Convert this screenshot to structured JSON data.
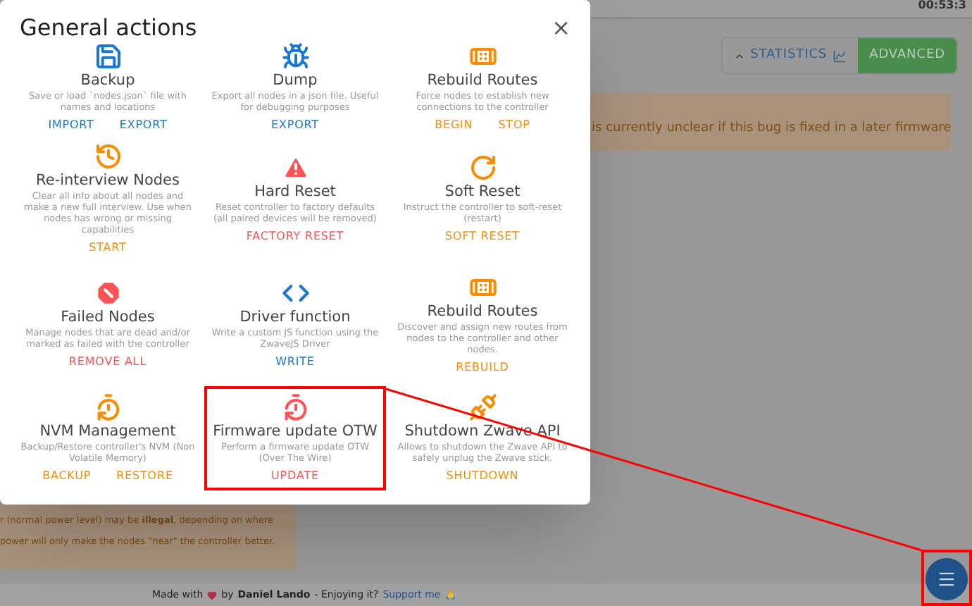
{
  "top_bar": {
    "clock": "00:53:3"
  },
  "toolbar": {
    "buttons": [
      {
        "label": "STATISTICS",
        "kind": "outline"
      },
      {
        "label": "ADVANCED",
        "kind": "filled"
      }
    ]
  },
  "alert_top": {
    "text": "is currently unclear if this bug is fixed in a later firmware"
  },
  "alert_bottom": {
    "lines": [
      "r (normal power level) may be **illegal**, depending on where",
      "power will only make the nodes \"near\" the controller better."
    ]
  },
  "footer": {
    "made_with": "Made with",
    "by": "by",
    "author": "Daniel Lando",
    "enjoying": "- Enjoying it?",
    "link": "Support me",
    "emoji": "🙏"
  },
  "dialog": {
    "title": "General actions",
    "close": "×",
    "actions": [
      {
        "kind": "save",
        "color": "#1976d2",
        "title": "Backup",
        "description": "Save or load `nodes.json` file with names and locations",
        "buttons": [
          "IMPORT",
          "EXPORT"
        ],
        "highlighted": false
      },
      {
        "kind": "bug",
        "color": "#1976d2",
        "title": "Dump",
        "description": "Export all nodes in a json file. Useful for debugging purposes",
        "buttons": [
          "EXPORT"
        ],
        "highlighted": false
      },
      {
        "kind": "bandage",
        "color": "#fb8c00",
        "title": "Rebuild Routes",
        "description": "Force nodes to establish new connections to the controller",
        "buttons": [
          "BEGIN",
          "STOP"
        ],
        "highlighted": false
      },
      {
        "kind": "history",
        "color": "#fb8c00",
        "title": "Re-interview Nodes",
        "description": "Clear all info about all nodes and make a new full interview. Use when nodes has wrong or missing capabilities",
        "buttons": [
          "START"
        ],
        "highlighted": false
      },
      {
        "kind": "warning",
        "color": "#ff5252",
        "title": "Hard Reset",
        "description": "Reset controller to factory defaults (all paired devices will be removed)",
        "buttons": [
          "FACTORY RESET"
        ],
        "highlighted": false
      },
      {
        "kind": "refresh",
        "color": "#fb8c00",
        "title": "Soft Reset",
        "description": "Instruct the controller to soft-reset (restart)",
        "buttons": [
          "SOFT RESET"
        ],
        "highlighted": false
      },
      {
        "kind": "cross",
        "color": "#ff5252",
        "title": "Failed Nodes",
        "description": "Manage nodes that are dead and/or marked as failed with the controller",
        "buttons": [
          "REMOVE ALL"
        ],
        "highlighted": false
      },
      {
        "kind": "code",
        "color": "#1976d2",
        "title": "Driver function",
        "description": "Write a custom JS function using the ZwaveJS Driver",
        "buttons": [
          "WRITE"
        ],
        "highlighted": false
      },
      {
        "kind": "bandage",
        "color": "#fb8c00",
        "title": "Rebuild Routes",
        "description": "Discover and assign new routes from nodes to the controller and other nodes.",
        "buttons": [
          "REBUILD"
        ],
        "highlighted": false
      },
      {
        "kind": "restore",
        "color": "#fb8c00",
        "title": "NVM Management",
        "description": "Backup/Restore controller's NVM (Non Volatile Memory)",
        "buttons": [
          "BACKUP",
          "RESTORE"
        ],
        "highlighted": false
      },
      {
        "kind": "restore",
        "color": "#ff5252",
        "title": "Firmware update OTW",
        "description": "Perform a firmware update OTW (Over The Wire)",
        "buttons": [
          "UPDATE"
        ],
        "highlighted": true
      },
      {
        "kind": "unplug",
        "color": "#fb8c00",
        "title": "Shutdown Zwave API",
        "description": "Allows to shutdown the Zwave API to safely unplug the Zwave stick.",
        "buttons": [
          "SHUTDOWN"
        ],
        "highlighted": false
      }
    ]
  },
  "fab": {
    "highlighted": true
  }
}
